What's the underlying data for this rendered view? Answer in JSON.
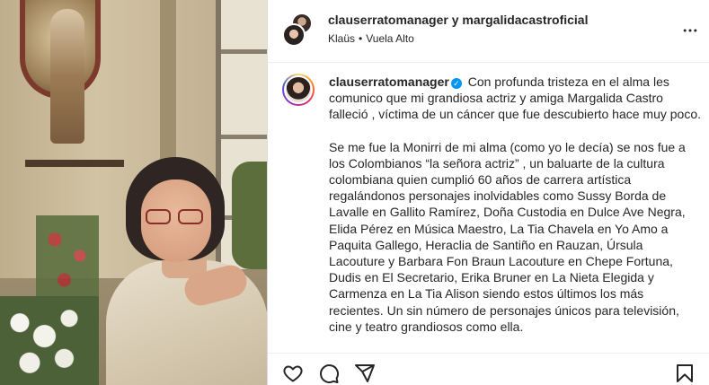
{
  "header": {
    "account_primary": "clauserratomanager",
    "joiner": "y",
    "account_secondary": "margalidacastroficial",
    "audio_artist": "Klaüs",
    "audio_separator": "•",
    "audio_title": "Vuela Alto",
    "more_icon": "more-horizontal-icon"
  },
  "caption": {
    "username": "clauserratomanager",
    "verified_icon": "verified-badge-icon",
    "paragraph1": "Con profunda tristeza en el alma les comunico que mi grandiosa actriz y amiga Margalida Castro falleció , víctima de un cáncer que fue descubierto hace muy poco.",
    "paragraph2": "Se me fue la Monirri de mi alma (como yo le decía) se nos fue a los Colombianos “la señora actriz” , un baluarte de la cultura colombiana quien cumplió 60 años de carrera artística regalándonos personajes inolvidables como Sussy Borda de Lavalle en Gallito Ramírez, Doña Custodia en Dulce Ave Negra, Elida Pérez en Música Maestro, La Tia Chavela en Yo Amo a Paquita Gallego, Heraclia de Santiño en Rauzan, Úrsula Lacouture y Barbara Fon Braun Lacouture en Chepe Fortuna, Dudis en El Secretario, Erika Bruner en La Nieta Elegida y Carmenza en La Tia Alison siendo estos últimos los más recientes. Un sin número de personajes únicos para televisión, cine y teatro grandiosos como ella."
  },
  "actions": {
    "like_icon": "heart-icon",
    "comment_icon": "comment-icon",
    "share_icon": "share-icon",
    "save_icon": "bookmark-icon"
  }
}
